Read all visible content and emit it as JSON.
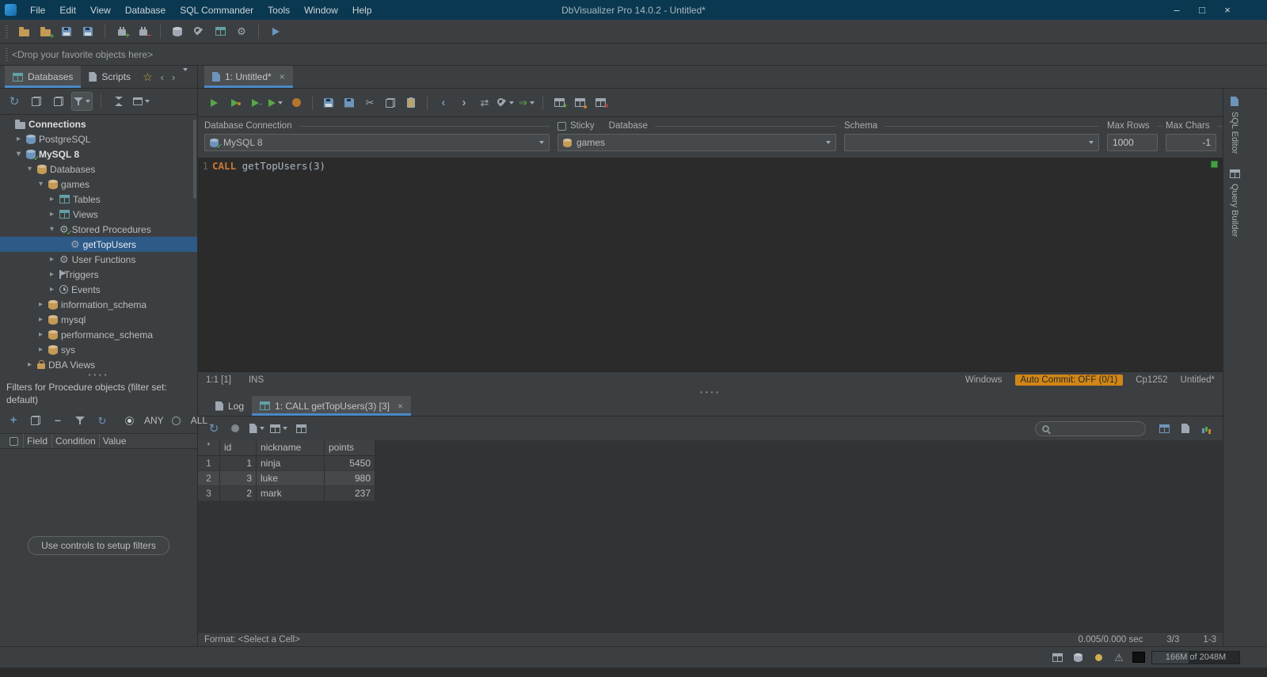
{
  "titlebar": {
    "title": "DbVisualizer Pro 14.0.2 - Untitled*",
    "menus": [
      "File",
      "Edit",
      "View",
      "Database",
      "SQL Commander",
      "Tools",
      "Window",
      "Help"
    ]
  },
  "favorites_bar": {
    "hint": "<Drop your favorite objects here>"
  },
  "ui": {
    "splitter_dots": "····"
  },
  "left_panel": {
    "tabs": [
      {
        "label": "Databases",
        "selected": true
      },
      {
        "label": "Scripts",
        "selected": false
      }
    ],
    "tree": [
      {
        "label": "Connections",
        "level": 0,
        "icon": "connections-icon",
        "expand": "none",
        "bold": true
      },
      {
        "label": "PostgreSQL",
        "level": 1,
        "icon": "database-server-icon",
        "expand": "collapsed"
      },
      {
        "label": "MySQL 8",
        "level": 1,
        "icon": "database-server-connected-icon",
        "expand": "expanded",
        "bold": true
      },
      {
        "label": "Databases",
        "level": 2,
        "icon": "databases-icon",
        "expand": "expanded"
      },
      {
        "label": "games",
        "level": 3,
        "icon": "database-icon",
        "expand": "expanded"
      },
      {
        "label": "Tables",
        "level": 4,
        "icon": "table-icon",
        "expand": "collapsed"
      },
      {
        "label": "Views",
        "level": 4,
        "icon": "views-icon",
        "expand": "collapsed"
      },
      {
        "label": "Stored Procedures",
        "level": 4,
        "icon": "procedures-icon",
        "expand": "expanded"
      },
      {
        "label": "getTopUsers",
        "level": 5,
        "icon": "procedure-icon",
        "expand": "none",
        "selected": true
      },
      {
        "label": "User Functions",
        "level": 4,
        "icon": "functions-icon",
        "expand": "collapsed"
      },
      {
        "label": "Triggers",
        "level": 4,
        "icon": "triggers-icon",
        "expand": "collapsed"
      },
      {
        "label": "Events",
        "level": 4,
        "icon": "events-icon",
        "expand": "collapsed"
      },
      {
        "label": "information_schema",
        "level": 3,
        "icon": "database-icon",
        "expand": "collapsed"
      },
      {
        "label": "mysql",
        "level": 3,
        "icon": "database-icon",
        "expand": "collapsed"
      },
      {
        "label": "performance_schema",
        "level": 3,
        "icon": "database-icon",
        "expand": "collapsed"
      },
      {
        "label": "sys",
        "level": 3,
        "icon": "database-icon",
        "expand": "collapsed"
      },
      {
        "label": "DBA Views",
        "level": 2,
        "icon": "dba-views-icon",
        "expand": "collapsed"
      }
    ],
    "filters": {
      "title": "Filters for Procedure objects (filter set: default)",
      "any_label": "ANY",
      "all_label": "ALL",
      "columns": [
        "Field",
        "Condition",
        "Value"
      ],
      "setup_button": "Use controls to setup filters"
    }
  },
  "sql_editor": {
    "tab_label": "1: Untitled*",
    "fields": {
      "connection_label": "Database Connection",
      "connection_value": "MySQL 8",
      "sticky_label": "Sticky",
      "database_label": "Database",
      "database_value": "games",
      "schema_label": "Schema",
      "schema_value": "",
      "max_rows_label": "Max Rows",
      "max_rows_value": "1000",
      "max_chars_label": "Max Chars",
      "max_chars_value": "-1"
    },
    "code": {
      "line_number": "1",
      "keyword": "CALL",
      "text": " getTopUsers(3)"
    },
    "status": {
      "caret": "1:1 [1]",
      "insert_mode": "INS",
      "line_separator": "Windows",
      "auto_commit": "Auto Commit: OFF (0/1)",
      "encoding": "Cp1252",
      "buffer": "Untitled*"
    }
  },
  "results": {
    "tabs": [
      {
        "label": "Log",
        "selected": false
      },
      {
        "label": "1: CALL getTopUsers(3) [3]",
        "selected": true
      }
    ],
    "grid": {
      "corner": "*",
      "columns": [
        "id",
        "nickname",
        "points"
      ],
      "rows": [
        {
          "num": "1",
          "cells": [
            "1",
            "ninja",
            "5450"
          ],
          "selected": false
        },
        {
          "num": "2",
          "cells": [
            "3",
            "luke",
            "980"
          ],
          "selected": true
        },
        {
          "num": "3",
          "cells": [
            "2",
            "mark",
            "237"
          ],
          "selected": false
        }
      ]
    },
    "footer": {
      "format": "Format: <Select a Cell>",
      "timing": "0.005/0.000 sec",
      "count": "3/3",
      "range": "1-3"
    }
  },
  "right_strip": {
    "tabs": [
      "SQL Editor",
      "Query Builder"
    ]
  },
  "statusbar": {
    "memory": "166M of 2048M"
  },
  "colors": {
    "titlebar_bg": "#0a3850",
    "accent_blue": "#4a88c7",
    "keyword_orange": "#cc7832",
    "auto_commit_bg": "#d18616",
    "tree_selection": "#2d5a87",
    "run_green": "#57a64a",
    "stop_orange": "#c8832b"
  },
  "icon_map": {
    "connections-icon": {
      "shape": "folder",
      "tone": "gray"
    },
    "database-server-icon": {
      "shape": "db",
      "tone": "blue"
    },
    "database-server-connected-icon": {
      "shape": "db",
      "tone": "blue",
      "overlay": "check"
    },
    "databases-icon": {
      "shape": "db",
      "tone": "amber"
    },
    "database-icon": {
      "shape": "db",
      "tone": "amber"
    },
    "table-icon": {
      "shape": "table",
      "tone": "teal"
    },
    "views-icon": {
      "shape": "table",
      "tone": "teal"
    },
    "procedures-icon": {
      "glyph": "⚙",
      "tone": "gray",
      "overlay": "check"
    },
    "procedure-icon": {
      "glyph": "⚙",
      "tone": "gray"
    },
    "functions-icon": {
      "glyph": "⚙",
      "tone": "gray"
    },
    "triggers-icon": {
      "shape": "flag",
      "tone": "gray"
    },
    "events-icon": {
      "shape": "clock",
      "tone": "gray"
    },
    "dba-views-icon": {
      "shape": "lock",
      "tone": "amber"
    }
  }
}
